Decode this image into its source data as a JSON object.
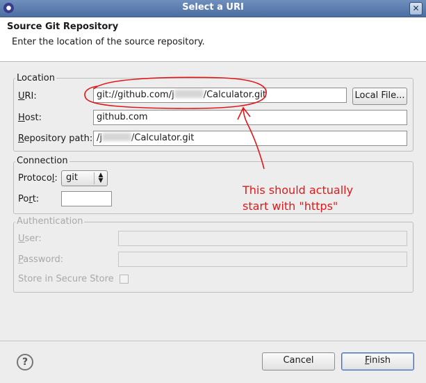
{
  "window": {
    "title": "Select a URI"
  },
  "header": {
    "title": "Source Git Repository",
    "description": "Enter the location of the source repository."
  },
  "location": {
    "group_label": "Location",
    "uri_label": "URI:",
    "uri_value_start": "git://github.com/j",
    "uri_value_end": "/Calculator.git",
    "local_file_label": "Local File...",
    "host_label": "Host:",
    "host_value": "github.com",
    "repo_path_label": "Repository path:",
    "repo_path_value_start": "/j",
    "repo_path_value_end": "/Calculator.git"
  },
  "connection": {
    "group_label": "Connection",
    "protocol_label": "Protocol:",
    "protocol_value": "git",
    "port_label": "Port:",
    "port_value": ""
  },
  "authentication": {
    "group_label": "Authentication",
    "user_label": "User:",
    "password_label": "Password:",
    "secure_store_label": "Store in Secure Store"
  },
  "annotation": {
    "line1": "This should actually",
    "line2": "start with \"https\"",
    "color": "#e11818"
  },
  "footer": {
    "cancel_label": "Cancel",
    "finish_label": "Finish"
  }
}
